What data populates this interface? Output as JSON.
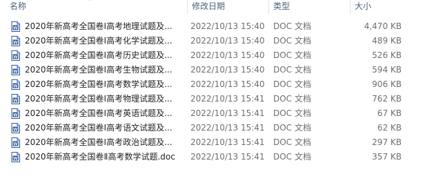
{
  "columns": {
    "name": "名称",
    "date": "修改日期",
    "type": "类型",
    "size": "大小"
  },
  "sort_indicator": "^",
  "files": [
    {
      "name": "2020年新高考全国卷Ⅰ高考地理试题及...",
      "date": "2022/10/13 15:40",
      "type": "DOC 文档",
      "size": "4,470 KB",
      "icon": "word-doc-icon"
    },
    {
      "name": "2020年新高考全国卷Ⅰ高考化学试题及...",
      "date": "2022/10/13 15:40",
      "type": "DOC 文档",
      "size": "489 KB",
      "icon": "word-doc-icon"
    },
    {
      "name": "2020年新高考全国卷Ⅰ高考历史试题及...",
      "date": "2022/10/13 15:40",
      "type": "DOC 文档",
      "size": "526 KB",
      "icon": "word-doc-icon"
    },
    {
      "name": "2020年新高考全国卷Ⅰ高考生物试题及...",
      "date": "2022/10/13 15:40",
      "type": "DOC 文档",
      "size": "594 KB",
      "icon": "word-doc-icon"
    },
    {
      "name": "2020年新高考全国卷Ⅰ高考数学试题及...",
      "date": "2022/10/13 15:40",
      "type": "DOC 文档",
      "size": "906 KB",
      "icon": "word-doc-icon"
    },
    {
      "name": "2020年新高考全国卷Ⅰ高考物理试题及...",
      "date": "2022/10/13 15:41",
      "type": "DOC 文档",
      "size": "762 KB",
      "icon": "word-doc-icon"
    },
    {
      "name": "2020年新高考全国卷Ⅰ高考英语试题及...",
      "date": "2022/10/13 15:41",
      "type": "DOC 文档",
      "size": "67 KB",
      "icon": "word-doc-icon"
    },
    {
      "name": "2020年新高考全国卷Ⅰ高考语文试题及...",
      "date": "2022/10/13 15:41",
      "type": "DOC 文档",
      "size": "62 KB",
      "icon": "word-doc-icon"
    },
    {
      "name": "2020年新高考全国卷Ⅰ高考政治试题及...",
      "date": "2022/10/13 15:41",
      "type": "DOC 文档",
      "size": "297 KB",
      "icon": "word-doc-icon"
    },
    {
      "name": "2020年新高考全国卷Ⅱ高考数学试题.doc",
      "date": "2022/10/13 15:41",
      "type": "DOC 文档",
      "size": "357 KB",
      "icon": "word-doc-icon"
    }
  ],
  "colors": {
    "header_text": "#4c607a",
    "name_text": "#1e1e1e",
    "meta_text": "#6d6d6d",
    "icon_blue": "#2b5797"
  }
}
